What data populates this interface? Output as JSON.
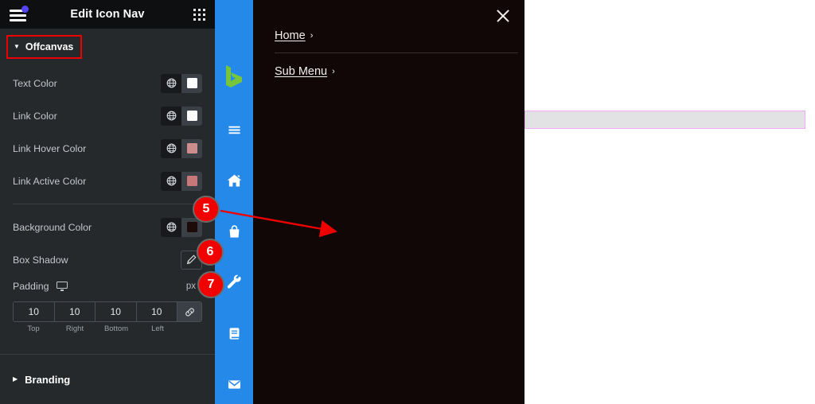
{
  "editor": {
    "header": {
      "title": "Edit Icon Nav",
      "menu_icon": "hamburger-icon",
      "notification_dot": true,
      "apps_icon": "grid-apps-icon"
    },
    "sections": [
      {
        "label": "Offcanvas",
        "expanded": true,
        "highlighted": true
      },
      {
        "label": "Branding",
        "expanded": false,
        "highlighted": false
      }
    ],
    "controls": [
      {
        "label": "Text Color",
        "type": "color",
        "swatch": "#ffffff",
        "globe_icon": "globe-icon"
      },
      {
        "label": "Link Color",
        "type": "color",
        "swatch": "#fbfbfb",
        "globe_icon": "globe-icon"
      },
      {
        "label": "Link Hover Color",
        "type": "color",
        "swatch": "#cd8d8d",
        "globe_icon": "globe-icon"
      },
      {
        "label": "Link Active Color",
        "type": "color",
        "swatch": "#c87878",
        "globe_icon": "globe-icon"
      },
      {
        "label": "Background Color",
        "type": "color",
        "swatch": "#1c0b09",
        "globe_icon": "globe-icon"
      }
    ],
    "box_shadow": {
      "label": "Box Shadow",
      "edit_icon": "pencil-icon"
    },
    "padding": {
      "label": "Padding",
      "device_icon": "desktop-monitor-icon",
      "unit": "px",
      "unit_caret": "˅",
      "link_icon": "link-chain-icon",
      "values": [
        "10",
        "10",
        "10",
        "10"
      ],
      "sides": [
        "Top",
        "Right",
        "Bottom",
        "Left"
      ]
    }
  },
  "icon_nav": {
    "logo": "brand-logo-icon",
    "items": [
      {
        "icon": "hamburger-menu-icon"
      },
      {
        "icon": "home-icon"
      },
      {
        "icon": "shopping-bag-icon"
      },
      {
        "icon": "wrench-icon"
      },
      {
        "icon": "book-icon"
      },
      {
        "icon": "envelope-icon"
      }
    ],
    "background": "#2489e8"
  },
  "offcanvas": {
    "close_icon": "close-x-icon",
    "background": "#100706",
    "menu": [
      {
        "label": "Home",
        "chevron": "›"
      },
      {
        "label": "Sub Menu",
        "chevron": "›"
      }
    ]
  },
  "page": {
    "highlighted_block": {
      "fill": "#e2e1e4",
      "border": "#f0a8f5"
    }
  },
  "annotations": {
    "badges": [
      {
        "number": "5",
        "color": "#f20000"
      },
      {
        "number": "6",
        "color": "#f20000"
      },
      {
        "number": "7",
        "color": "#f20000"
      }
    ],
    "arrow": {
      "color": "#ee0000",
      "from": "badge-5",
      "to": "offcanvas-background"
    }
  }
}
